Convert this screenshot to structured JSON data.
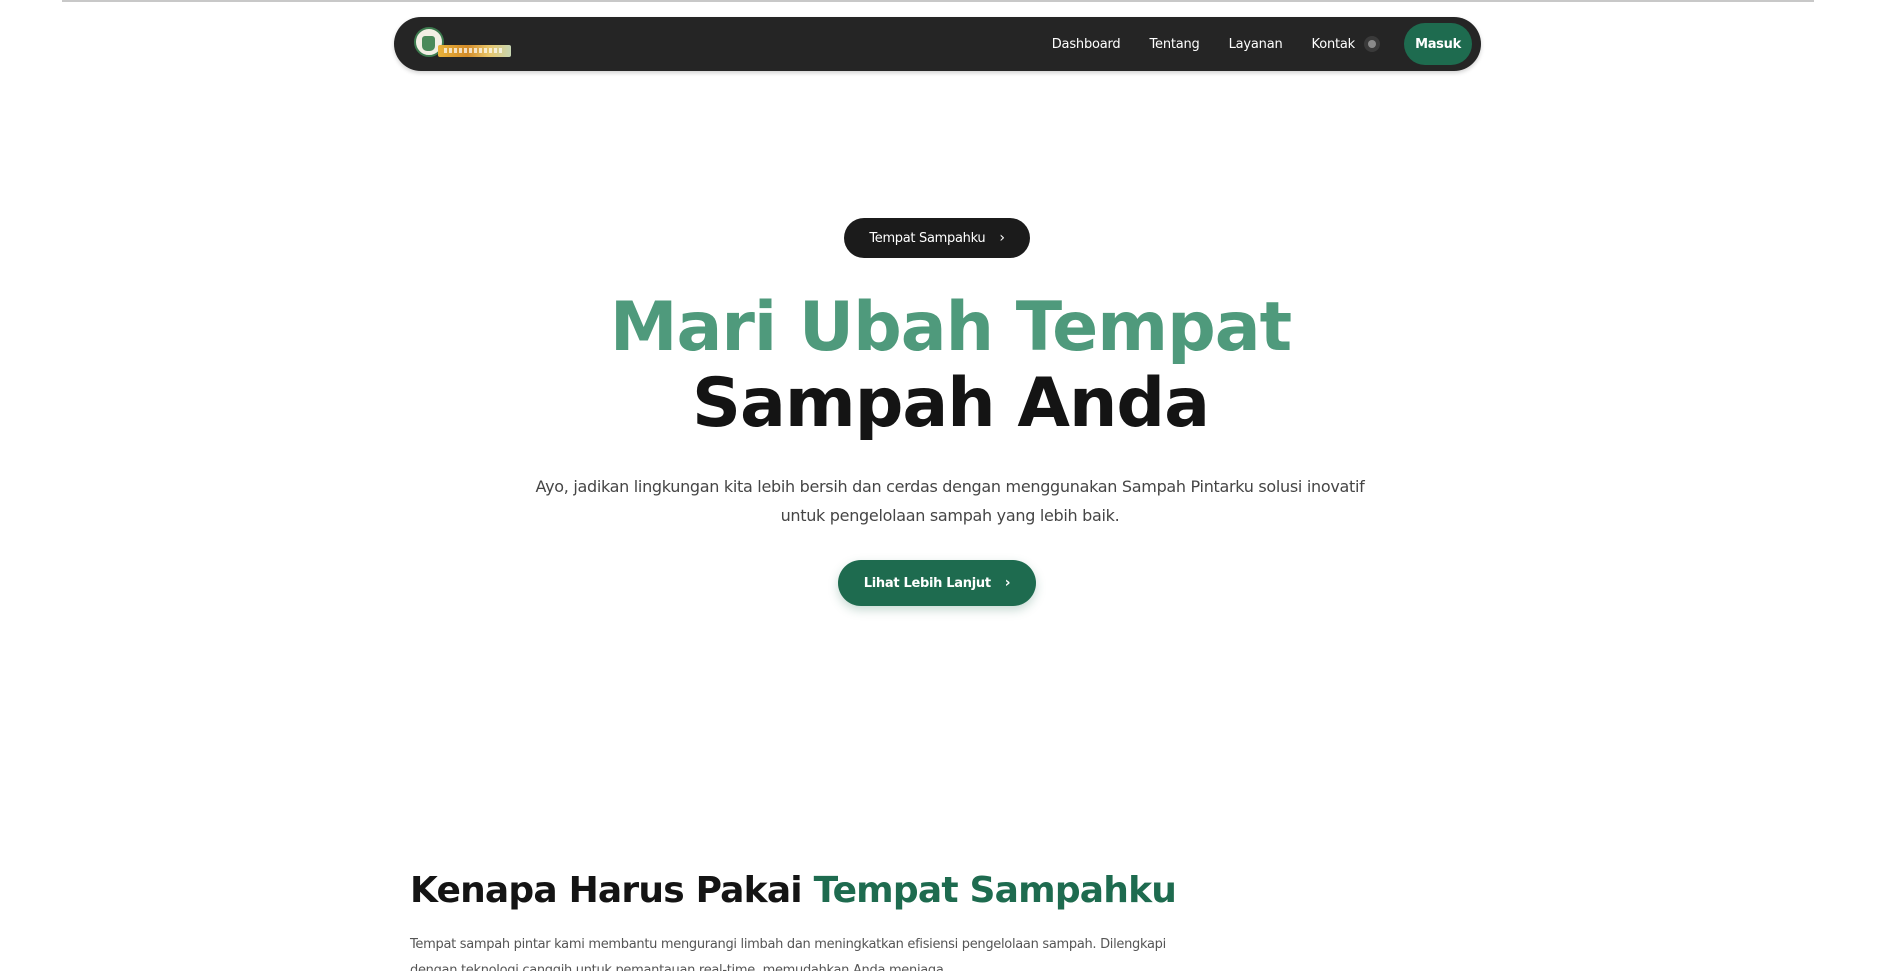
{
  "navbar": {
    "links": [
      "Dashboard",
      "Tentang",
      "Layanan",
      "Kontak"
    ],
    "login_label": "Masuk"
  },
  "hero": {
    "pill_label": "Tempat Sampahku",
    "pill_icon": "chevron-right-icon",
    "title_accent": "Mari Ubah Tempat",
    "title_dark": "Sampah Anda",
    "description": "Ayo, jadikan lingkungan kita lebih bersih dan cerdas dengan menggunakan Sampah Pintarku solusi inovatif untuk pengelolaan sampah yang lebih baik.",
    "cta_label": "Lihat Lebih Lanjut",
    "cta_icon": "chevron-right-icon"
  },
  "why": {
    "title_plain": "Kenapa Harus Pakai",
    "title_accent": "Tempat Sampahku",
    "description": "Tempat sampah pintar kami membantu mengurangi limbah dan meningkatkan efisiensi pengelolaan sampah. Dilengkapi dengan teknologi canggih untuk pemantauan real-time, memudahkan Anda menjaga"
  },
  "colors": {
    "accent_green": "#1e6b4f",
    "title_green": "#4f9a7c",
    "navbar_bg": "#252525"
  }
}
